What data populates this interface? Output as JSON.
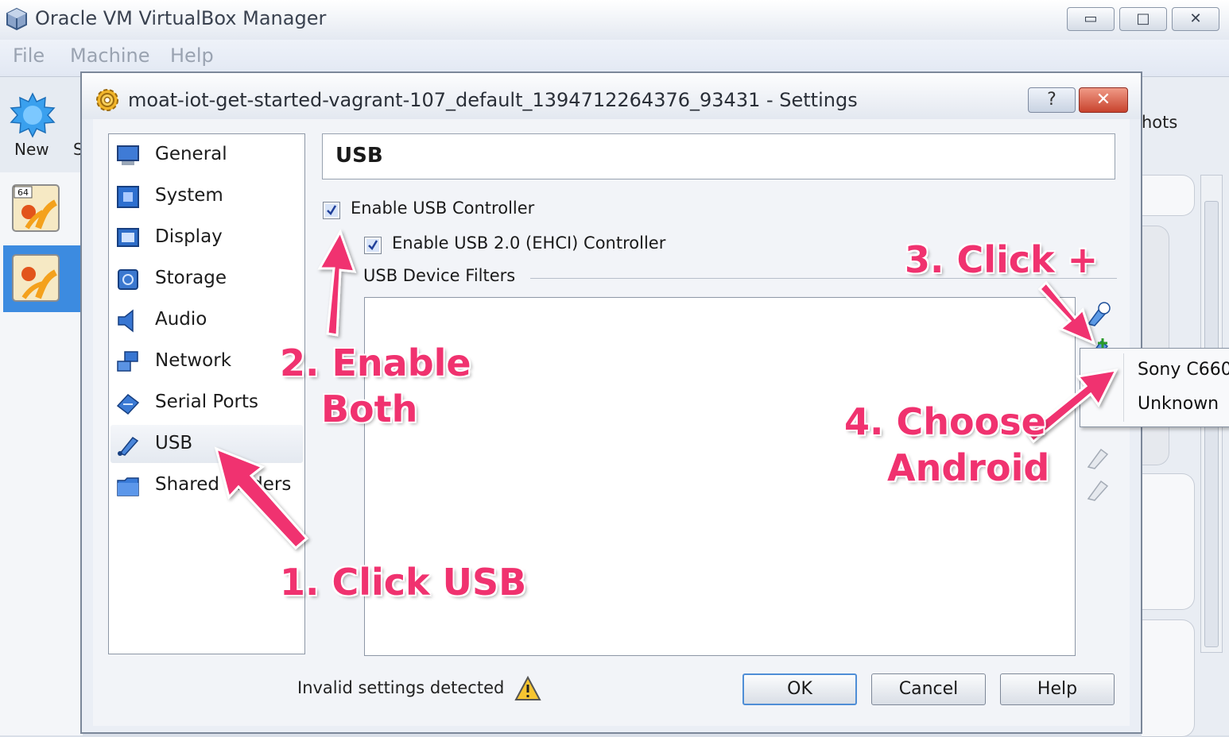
{
  "main_window": {
    "title": "Oracle VM VirtualBox Manager",
    "minimize_glyph": "▭",
    "maximize_glyph": "□",
    "close_glyph": "✕",
    "menu": [
      "File",
      "Machine",
      "Help"
    ],
    "toolbar_new": "New",
    "toolbar_partial": "S",
    "snapshots_partial": "hots",
    "vm_badge": "64"
  },
  "dialog": {
    "title": "moat-iot-get-started-vagrant-107_default_1394712264376_93431 - Settings",
    "help_glyph": "?",
    "close_glyph": "✕",
    "nav": [
      {
        "label": "General",
        "icon": "monitor-icon"
      },
      {
        "label": "System",
        "icon": "motherboard-icon"
      },
      {
        "label": "Display",
        "icon": "display-icon"
      },
      {
        "label": "Storage",
        "icon": "storage-icon"
      },
      {
        "label": "Audio",
        "icon": "speaker-icon"
      },
      {
        "label": "Network",
        "icon": "network-icon"
      },
      {
        "label": "Serial Ports",
        "icon": "serial-port-icon"
      },
      {
        "label": "USB",
        "icon": "usb-icon",
        "selected": true
      },
      {
        "label": "Shared Folders",
        "icon": "folder-icon"
      }
    ],
    "section_title": "USB",
    "enable_usb_label": "Enable USB Controller",
    "enable_usb_checked": true,
    "enable_usb2_label": "Enable USB 2.0 (EHCI) Controller",
    "enable_usb2_checked": true,
    "filters_label": "USB Device Filters",
    "invalid_label": "Invalid settings detected",
    "buttons": {
      "ok": "OK",
      "cancel": "Cancel",
      "help": "Help"
    },
    "popup_items": [
      "Sony C660",
      "Unknown"
    ]
  },
  "annotations": {
    "step1": "1. Click USB",
    "step2_line1": "2. Enable",
    "step2_line2": "Both",
    "step3": "3. Click +",
    "step4_line1": "4. Choose",
    "step4_line2": "Android",
    "color": "#f0326f"
  }
}
